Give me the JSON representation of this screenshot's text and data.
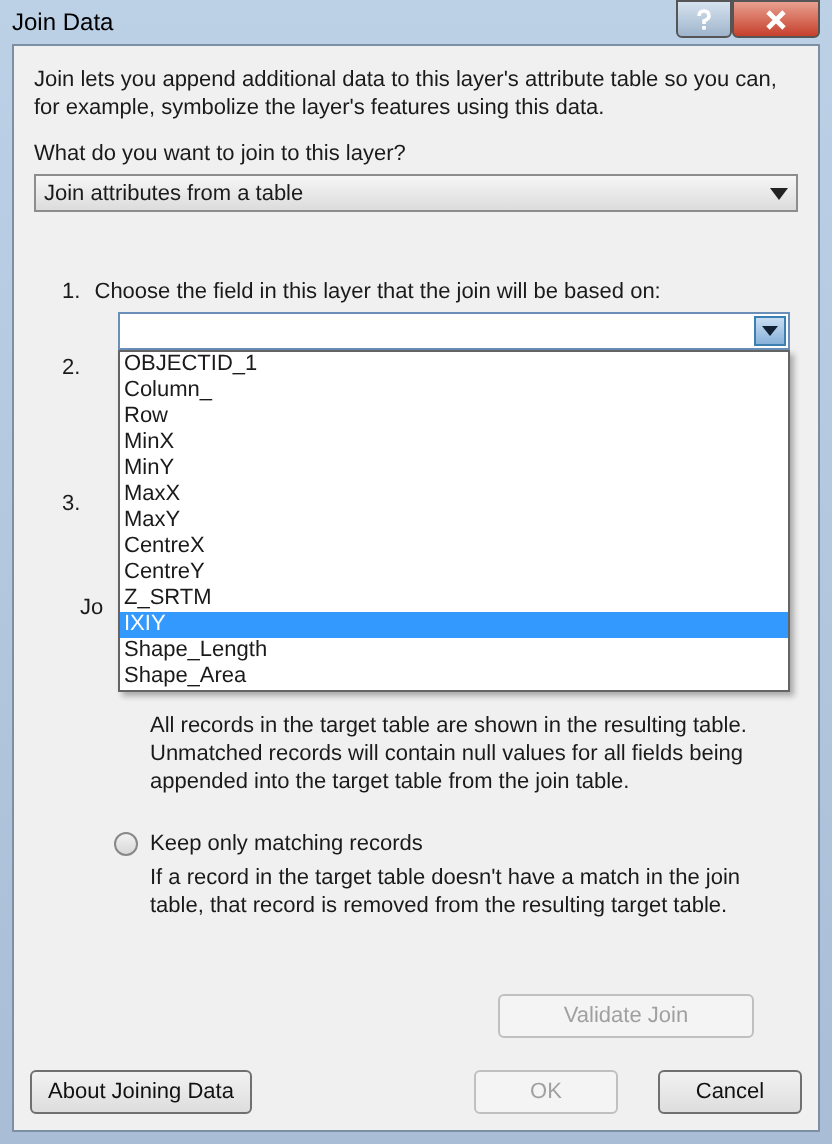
{
  "window": {
    "title": "Join Data"
  },
  "intro": "Join lets you append additional data to this layer's attribute table so you can, for example, symbolize the layer's features using this data.",
  "join_type": {
    "label": "What do you want to join to this layer?",
    "value": "Join attributes from a table"
  },
  "step_1": {
    "number": "1.",
    "label": "Choose the field in this layer that the join will be based on:",
    "options": [
      {
        "label": "OBJECTID_1",
        "selected": false
      },
      {
        "label": "Column_",
        "selected": false
      },
      {
        "label": "Row",
        "selected": false
      },
      {
        "label": "MinX",
        "selected": false
      },
      {
        "label": "MinY",
        "selected": false
      },
      {
        "label": "MaxX",
        "selected": false
      },
      {
        "label": "MaxY",
        "selected": false
      },
      {
        "label": "CentreX",
        "selected": false
      },
      {
        "label": "CentreY",
        "selected": false
      },
      {
        "label": "Z_SRTM",
        "selected": false
      },
      {
        "label": "IXIY",
        "selected": true
      },
      {
        "label": "Shape_Length",
        "selected": false
      },
      {
        "label": "Shape_Area",
        "selected": false
      }
    ]
  },
  "step_2": {
    "number": "2."
  },
  "step_3": {
    "number": "3."
  },
  "join_options_label": "Jo",
  "keep_all_description": "All records in the target table are shown in the resulting table. Unmatched records will contain null values for all fields being appended into the target table from the join table.",
  "keep_matching": {
    "label": "Keep only matching records",
    "selected": false,
    "description": "If a record in the target table doesn't have a match in the join table, that record is removed from the resulting target table."
  },
  "buttons": [
    {
      "kind": "validate",
      "label": "Validate Join",
      "disabled": true
    },
    {
      "kind": "about",
      "label": "About Joining Data",
      "disabled": false
    },
    {
      "kind": "ok",
      "label": "OK",
      "disabled": true
    },
    {
      "kind": "cancel",
      "label": "Cancel",
      "disabled": false
    }
  ]
}
